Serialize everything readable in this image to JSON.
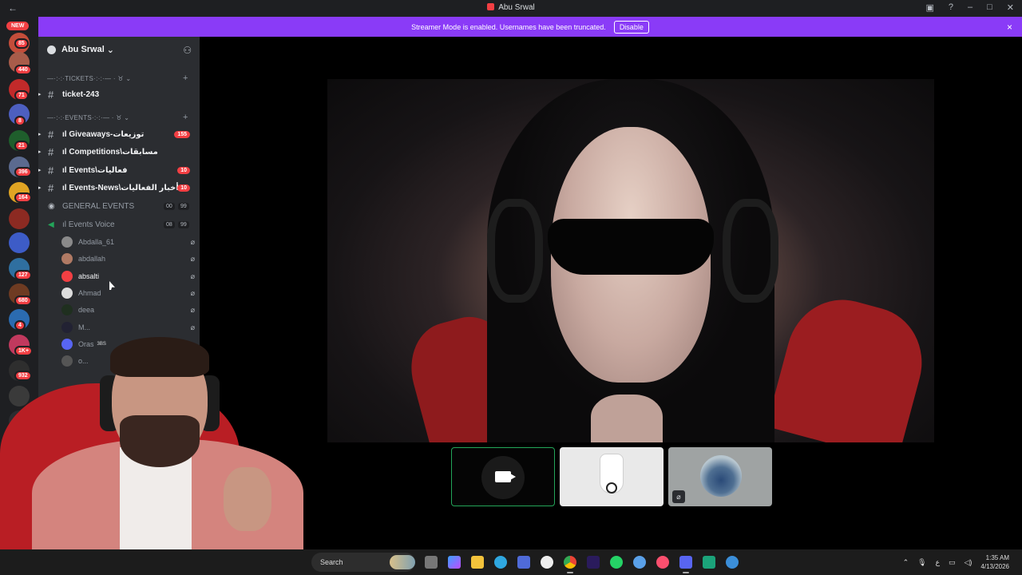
{
  "window": {
    "title": "Abu Srwal",
    "back_icon": "arrow-left-icon",
    "controls": [
      "inbox-icon",
      "help-icon",
      "minimize-icon",
      "maximize-icon",
      "close-icon"
    ]
  },
  "banner": {
    "text": "Streamer Mode is enabled. Usernames have been truncated.",
    "button": "Disable",
    "close": "×",
    "color": "#8a3bf7"
  },
  "servers": {
    "new_label": "NEW",
    "badges": [
      "85",
      "440",
      "71",
      "8",
      "21",
      "396",
      "164",
      "127",
      "680",
      "4",
      "1K+",
      "932"
    ],
    "add_icon": "+",
    "discover_icon": "compass-icon"
  },
  "guild": {
    "name": "Abu Srwal",
    "chevron": "⌄",
    "invite_icon": "add-user-icon"
  },
  "categories": {
    "tickets": "—·:·:·TICKETS·:·:·— · ♉ ⌄",
    "events": "—·:·:·EVENTS·:·:·— · ♉ ⌄"
  },
  "channels": [
    {
      "label": "ticket-243",
      "badge": ""
    },
    {
      "label": "ıl Giveaways-توزيعات",
      "badge": "155"
    },
    {
      "label": "ıl Competitions\\مسابقات",
      "badge": ""
    },
    {
      "label": "ıl Events\\فعاليات",
      "badge": "10"
    },
    {
      "label": "ıl Events-News\\أخبار الفعاليات...",
      "badge": "10"
    }
  ],
  "voice_channels": [
    {
      "label": "GENERAL EVENTS",
      "count_a": "00",
      "count_b": "99"
    },
    {
      "label": "ıl Events Voice",
      "count_a": "08",
      "count_b": "99"
    }
  ],
  "voice_users": [
    {
      "name": "Abdalla_61",
      "active": false
    },
    {
      "name": "abdallah",
      "active": false
    },
    {
      "name": "absalti",
      "active": true
    },
    {
      "name": "Ahmad",
      "active": false
    },
    {
      "name": "deea",
      "active": false
    },
    {
      "name": "M...",
      "active": false
    },
    {
      "name": "Oras",
      "tag": "3BS",
      "active": false
    },
    {
      "name": "o...",
      "active": false
    }
  ],
  "taskbar": {
    "search": "Search",
    "tray_lang": "ع",
    "time": "1:35 AM",
    "date": "4/13/2026"
  }
}
